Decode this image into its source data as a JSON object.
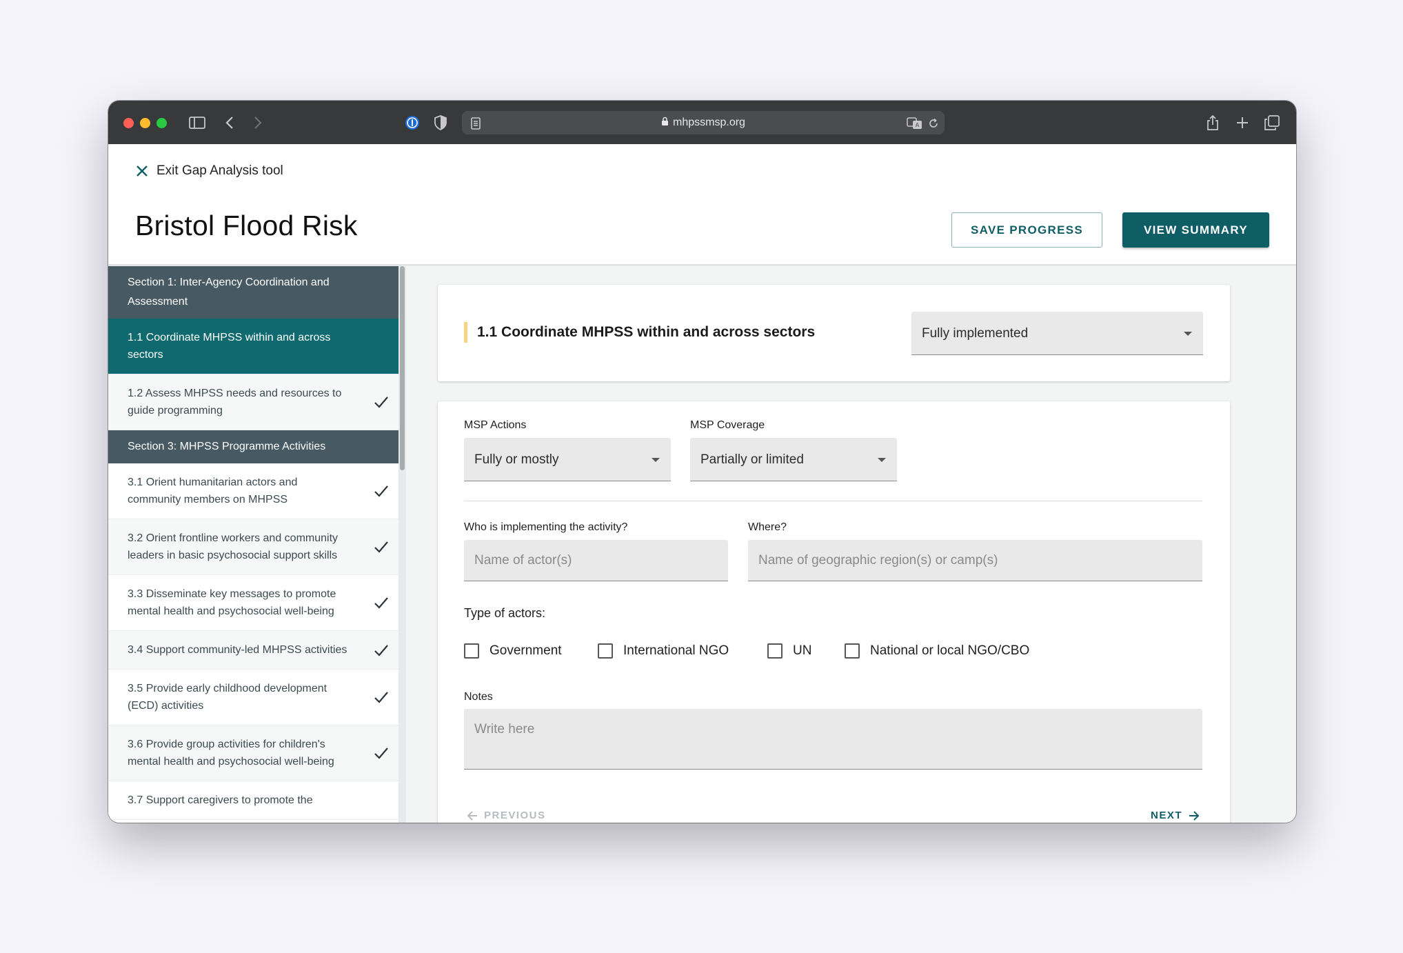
{
  "browser": {
    "url": "mhpssmsp.org"
  },
  "header": {
    "exit_label": "Exit Gap Analysis tool",
    "title": "Bristol Flood Risk",
    "save_label": "SAVE PROGRESS",
    "summary_label": "VIEW SUMMARY"
  },
  "sidebar": {
    "section_1": "Section 1: Inter-Agency Coordination and Assessment",
    "section_1_items": [
      {
        "label": "1.1 Coordinate MHPSS within and across sectors",
        "active": true,
        "done": false
      },
      {
        "label": "1.2 Assess MHPSS needs and resources to guide programming",
        "active": false,
        "done": true
      }
    ],
    "section_3": "Section 3: MHPSS Programme Activities",
    "section_3_items": [
      {
        "label": "3.1 Orient humanitarian actors and community members on MHPSS",
        "done": true
      },
      {
        "label": "3.2 Orient frontline workers and community leaders in basic psychosocial support skills",
        "done": true
      },
      {
        "label": "3.3 Disseminate key messages to promote mental health and psychosocial well-being",
        "done": true
      },
      {
        "label": "3.4 Support community-led MHPSS activities",
        "done": true
      },
      {
        "label": "3.5 Provide early childhood development (ECD) activities",
        "done": true
      },
      {
        "label": "3.6 Provide group activities for children's mental health and psychosocial well-being",
        "done": true
      },
      {
        "label": "3.7 Support caregivers to promote the",
        "done": false
      }
    ]
  },
  "main": {
    "indicator_title": "1.1 Coordinate MHPSS within and across sectors",
    "status_value": "Fully implemented",
    "msp_actions_label": "MSP Actions",
    "msp_actions_value": "Fully or mostly",
    "msp_coverage_label": "MSP Coverage",
    "msp_coverage_value": "Partially or limited",
    "who_label": "Who is implementing the activity?",
    "who_placeholder": "Name of actor(s)",
    "where_label": "Where?",
    "where_placeholder": "Name of geographic region(s) or camp(s)",
    "type_label": "Type of actors:",
    "actor_types": [
      "Government",
      "International NGO",
      "UN",
      "National or local NGO/CBO"
    ],
    "notes_label": "Notes",
    "notes_placeholder": "Write here",
    "previous_label": "PREVIOUS",
    "next_label": "NEXT"
  },
  "colors": {
    "brand_teal": "#0f5e66",
    "section_header": "#475a63",
    "indicator_accent": "#f6d57e"
  }
}
